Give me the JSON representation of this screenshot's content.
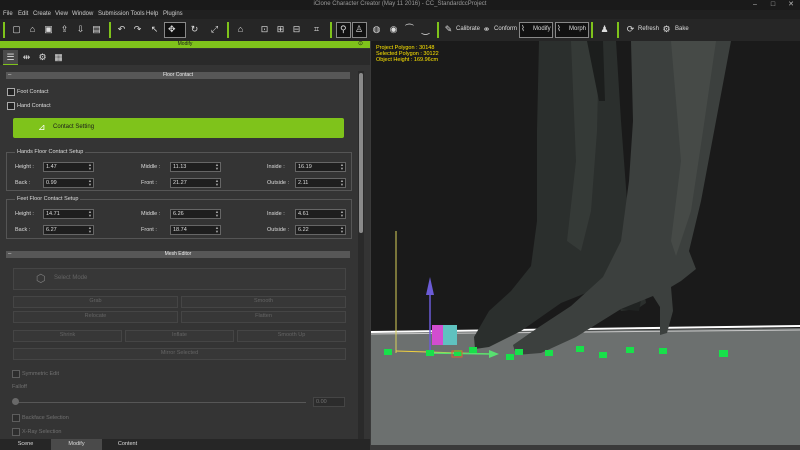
{
  "window": {
    "title": "iClone Character Creator (May 11 2016) - CC_StandardccProject"
  },
  "menu": [
    "File",
    "Edit",
    "Create",
    "View",
    "Window",
    "Submission Tools",
    "Help",
    "Plugins"
  ],
  "toolbar": {
    "calibrate": "Calibrate",
    "conform": "Conform",
    "modify": "Modify",
    "morph": "Morph",
    "refresh": "Refresh",
    "bake": "Bake"
  },
  "panel": {
    "title": "Modify",
    "floor_contact": {
      "title": "Floor Contact",
      "foot_contact": "Foot Contact",
      "hand_contact": "Hand Contact",
      "contact_setting": "Contact Setting",
      "hands_group": {
        "title": "Hands Floor Contact Setup",
        "fields": [
          {
            "label": "Height :",
            "value": "1.47"
          },
          {
            "label": "Middle :",
            "value": "11.13"
          },
          {
            "label": "Inside :",
            "value": "16.19"
          },
          {
            "label": "Back :",
            "value": "0.99"
          },
          {
            "label": "Front :",
            "value": "21.27"
          },
          {
            "label": "Outside :",
            "value": "2.11"
          }
        ]
      },
      "feet_group": {
        "title": "Feet Floor Contact Setup",
        "fields": [
          {
            "label": "Height :",
            "value": "14.71"
          },
          {
            "label": "Middle :",
            "value": "6.26"
          },
          {
            "label": "Inside :",
            "value": "4.61"
          },
          {
            "label": "Back :",
            "value": "6.27"
          },
          {
            "label": "Front :",
            "value": "18.74"
          },
          {
            "label": "Outside :",
            "value": "6.22"
          }
        ]
      }
    },
    "mesh_editor": {
      "title": "Mesh Editor",
      "select_mode": "Select Mode",
      "row1": [
        "Grab",
        "Smooth"
      ],
      "row2": [
        "Relocate",
        "Flatten"
      ],
      "row3": [
        "Shrink",
        "Inflate",
        "Smooth Up"
      ],
      "mirror": "Mirror Selected",
      "symmetry": "Symmetric Edit",
      "falloff": "Falloff",
      "falloff_value": "0.00",
      "backface": "Backface Selection",
      "xray": "X-Ray Selection"
    },
    "bottom_tabs": [
      "Scene",
      "Modify",
      "Content"
    ]
  },
  "viewport": {
    "project_polygon": "Project Polygon : 30148",
    "selected_polygon": "Selected Polygon : 30122",
    "object_height": "Object Height : 169.96cm"
  }
}
